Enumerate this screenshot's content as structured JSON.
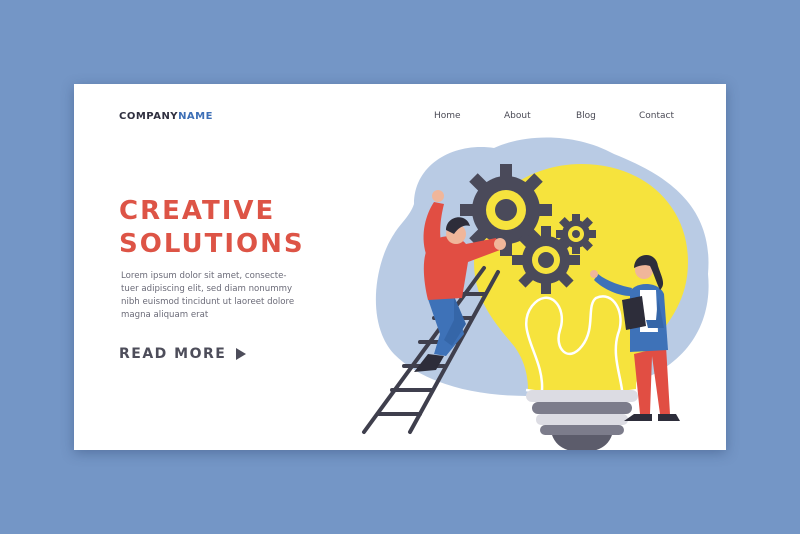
{
  "brand": {
    "name_part1": "COMPANY",
    "name_part2": "NAME"
  },
  "nav": {
    "items": [
      {
        "label": "Home"
      },
      {
        "label": "About"
      },
      {
        "label": "Blog"
      },
      {
        "label": "Contact"
      }
    ]
  },
  "hero": {
    "headline_line1": "CREATIVE",
    "headline_line2": "SOLUTIONS",
    "body_lines": [
      "Lorem ipsum dolor sit amet, consecte-",
      "tuer adipiscing elit, sed diam nonummy",
      "nibh euismod tincidunt ut laoreet dolore",
      "magna aliquam erat"
    ],
    "cta_label": "READ MORE"
  },
  "illustration": {
    "icons": [
      "lightbulb-icon",
      "gear-icon",
      "ladder-icon"
    ]
  },
  "colors": {
    "background": "#7496c6",
    "card": "#ffffff",
    "headline": "#dd5446",
    "brand_accent": "#3d6fb6",
    "bulb": "#f6e33d",
    "gear": "#4a4a5a",
    "blob": "#b9cbe4"
  }
}
